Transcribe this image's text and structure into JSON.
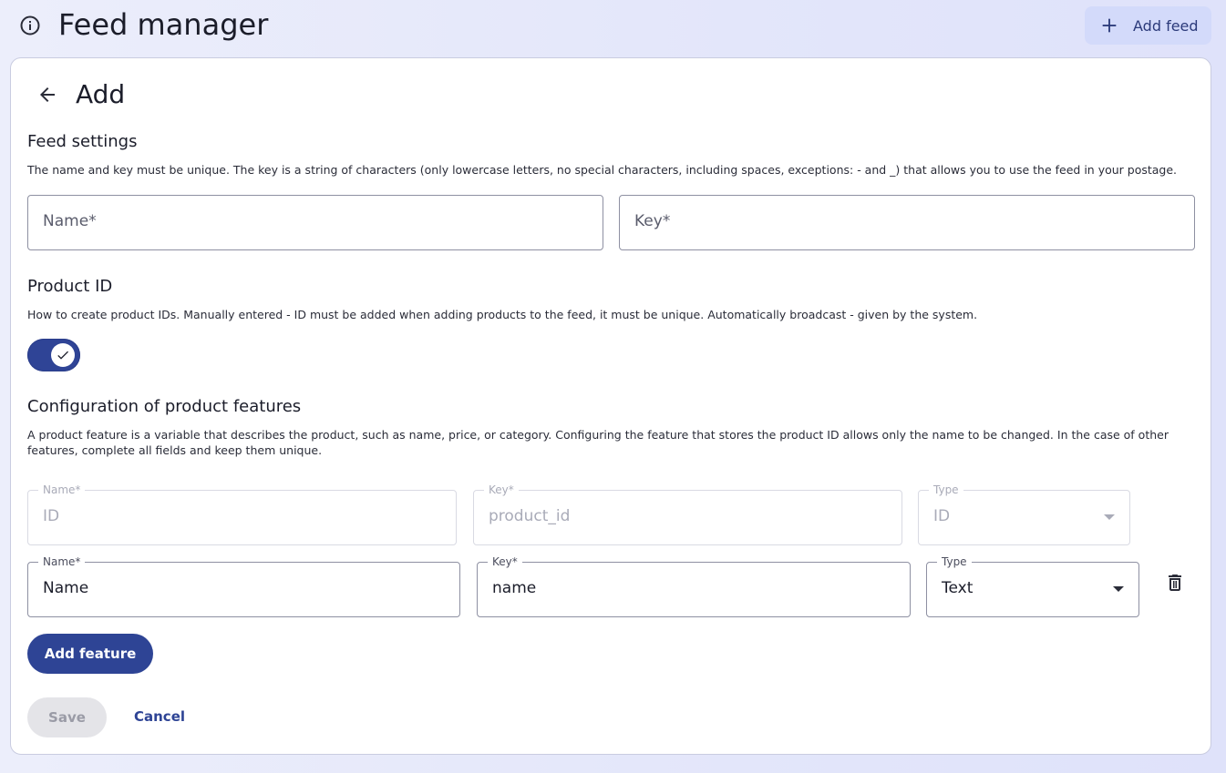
{
  "header": {
    "title": "Feed manager",
    "add_feed_label": "Add feed"
  },
  "page": {
    "title": "Add"
  },
  "feed_settings": {
    "title": "Feed settings",
    "description": "The name and key must be unique. The key is a string of characters (only lowercase letters, no special characters, including spaces, exceptions: - and _) that allows you to use the feed in your postage.",
    "name_placeholder": "Name*",
    "key_placeholder": "Key*"
  },
  "product_id": {
    "title": "Product ID",
    "description": "How to create product IDs. Manually entered - ID must be added when adding products to the feed, it must be unique. Automatically broadcast - given by the system.",
    "toggle_on": true
  },
  "features": {
    "title": "Configuration of product features",
    "description": "A product feature is a variable that describes the product, such as name, price, or category. Configuring the feature that stores the product ID allows only the name to be changed. In the case of other features, complete all fields and keep them unique.",
    "rows": [
      {
        "name_label": "Name*",
        "name_value": "ID",
        "key_label": "Key*",
        "key_value": "product_id",
        "type_label": "Type",
        "type_value": "ID",
        "disabled": true
      },
      {
        "name_label": "Name*",
        "name_value": "Name",
        "key_label": "Key*",
        "key_value": "name",
        "type_label": "Type",
        "type_value": "Text",
        "disabled": false
      }
    ],
    "add_feature_label": "Add feature"
  },
  "actions": {
    "save_label": "Save",
    "cancel_label": "Cancel"
  },
  "colors": {
    "primary": "#2e4495",
    "background": "#e3e6fa",
    "add_feed_bg": "#d3dafa"
  }
}
